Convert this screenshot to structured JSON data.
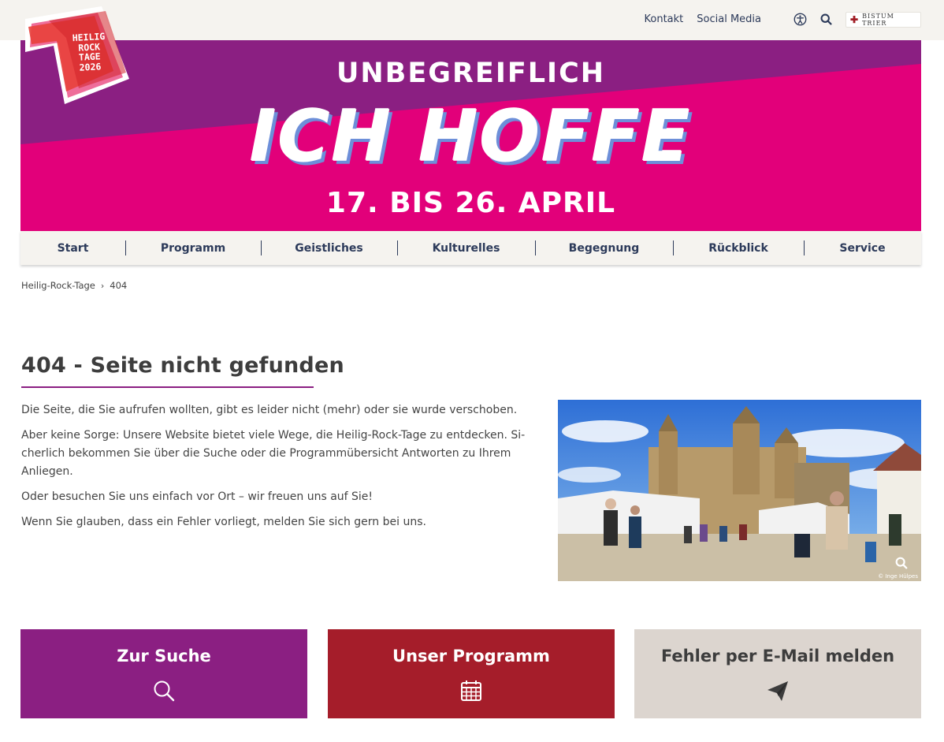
{
  "topbar": {
    "links": [
      "Kontakt",
      "Social Media"
    ],
    "bistum_label": "BISTUM TRIER"
  },
  "logo": {
    "lines": [
      "HEILIG",
      "ROCK",
      "TAGE",
      "2026"
    ]
  },
  "banner": {
    "line1": "UNBEGREIFLICH",
    "main": "ICH HOFFE",
    "line3": "17. BIS 26. APRIL"
  },
  "nav": {
    "items": [
      "Start",
      "Programm",
      "Geistliches",
      "Kulturelles",
      "Begegnung",
      "Rückblick",
      "Service"
    ]
  },
  "breadcrumb": {
    "home": "Heilig-Rock-Tage",
    "current": "404"
  },
  "main": {
    "title": "404 - Seite nicht gefunden",
    "paragraphs": [
      "Die Seite, die Sie aufrufen wollten, gibt es leider nicht (mehr) oder sie wurde verschoben.",
      "Aber keine Sorge: Unsere Website bietet viele Wege, die Heilig-Rock-Tage zu entdecken. Si-cherlich bekommen Sie über die Suche oder die Programmübersicht Antworten zu Ihrem Anliegen.",
      "Oder besuchen Sie uns einfach vor Ort – wir freuen uns auf Sie!",
      "Wenn Sie glauben, dass ein Fehler vorliegt, melden Sie sich gern bei uns."
    ],
    "photo_credit": "© Inge Hülpes"
  },
  "tiles": [
    {
      "label": "Zur Suche",
      "icon": "search-icon",
      "bg": "#8b1f82",
      "fg": "#ffffff"
    },
    {
      "label": "Unser Programm",
      "icon": "calendar-icon",
      "bg": "#a51d2a",
      "fg": "#ffffff"
    },
    {
      "label": "Fehler per E-Mail melden",
      "icon": "paper-plane-icon",
      "bg": "#dcd5cf",
      "fg": "#3d3d3d"
    }
  ],
  "colors": {
    "purple": "#8b1f82",
    "magenta": "#e2007a",
    "red": "#a51d2a",
    "beige": "#f5f3ef",
    "navy": "#2c3a5a"
  }
}
